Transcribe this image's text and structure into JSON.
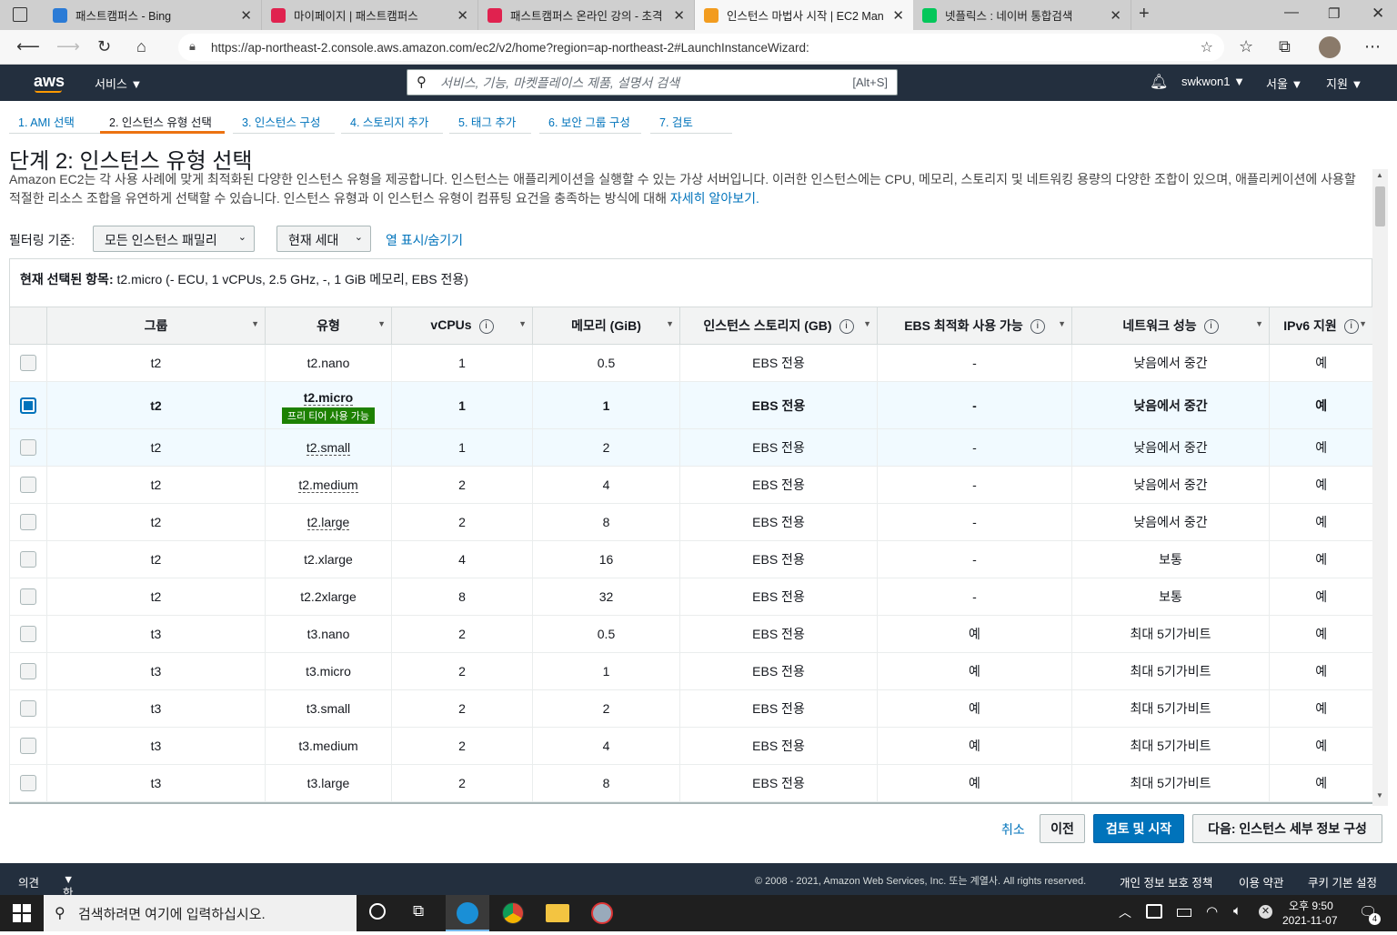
{
  "tabs": [
    {
      "title": "패스트캠퍼스 - Bing",
      "color": "#2b7bd6"
    },
    {
      "title": "마이페이지 | 패스트캠퍼스",
      "color": "#e0224f"
    },
    {
      "title": "패스트캠퍼스 온라인 강의 - 초격",
      "color": "#e0224f"
    },
    {
      "title": "인스턴스 마법사 시작 | EC2 Man",
      "color": "#f29c1f"
    },
    {
      "title": "넷플릭스 : 네이버 통합검색",
      "color": "#03c75a"
    }
  ],
  "browser": {
    "url": "https://ap-northeast-2.console.aws.amazon.com/ec2/v2/home?region=ap-northeast-2#LaunchInstanceWizard:"
  },
  "aws": {
    "logo": "aws",
    "services": "서비스",
    "search_placeholder": "서비스, 기능, 마켓플레이스 제품, 설명서 검색",
    "search_shortcut": "[Alt+S]",
    "user": "swkwon1",
    "region": "서울",
    "support": "지원"
  },
  "steps": [
    "1. AMI 선택",
    "2. 인스턴스 유형 선택",
    "3. 인스턴스 구성",
    "4. 스토리지 추가",
    "5. 태그 추가",
    "6. 보안 그룹 구성",
    "7. 검토"
  ],
  "page": {
    "title": "단계 2: 인스턴스 유형 선택",
    "description": "Amazon EC2는 각 사용 사례에 맞게 최적화된 다양한 인스턴스 유형을 제공합니다. 인스턴스는 애플리케이션을 실행할 수 있는 가상 서버입니다. 이러한 인스턴스에는 CPU, 메모리, 스토리지 및 네트워킹 용량의 다양한 조합이 있으며, 애플리케이션에 사용할 적절한 리소스 조합을 유연하게 선택할 수 있습니다. 인스턴스 유형과 이 인스턴스 유형이 컴퓨팅 요건을 충족하는 방식에 대해",
    "learn_more": "자세히 알아보기.",
    "filter_label": "필터링 기준:",
    "filter_family": "모든 인스턴스 패밀리",
    "filter_generation": "현재 세대",
    "toggle_columns": "열 표시/숨기기",
    "selected_label": "현재 선택된 항목:",
    "selected_value": "t2.micro (- ECU, 1 vCPUs, 2.5 GHz, -, 1 GiB 메모리, EBS 전용)"
  },
  "table": {
    "headers": [
      "그룹",
      "유형",
      "vCPUs",
      "메모리 (GiB)",
      "인스턴스 스토리지 (GB)",
      "EBS 최적화 사용 가능",
      "네트워크 성능",
      "IPv6 지원"
    ],
    "free_tier_badge": "프리 티어 사용 가능",
    "rows": [
      {
        "group": "t2",
        "type": "t2.nano",
        "vcpu": "1",
        "mem": "0.5",
        "storage": "EBS 전용",
        "ebs": "-",
        "net": "낮음에서 중간",
        "ipv6": "예",
        "checked": false
      },
      {
        "group": "t2",
        "type": "t2.micro",
        "vcpu": "1",
        "mem": "1",
        "storage": "EBS 전용",
        "ebs": "-",
        "net": "낮음에서 중간",
        "ipv6": "예",
        "checked": true
      },
      {
        "group": "t2",
        "type": "t2.small",
        "vcpu": "1",
        "mem": "2",
        "storage": "EBS 전용",
        "ebs": "-",
        "net": "낮음에서 중간",
        "ipv6": "예",
        "checked": false
      },
      {
        "group": "t2",
        "type": "t2.medium",
        "vcpu": "2",
        "mem": "4",
        "storage": "EBS 전용",
        "ebs": "-",
        "net": "낮음에서 중간",
        "ipv6": "예",
        "checked": false
      },
      {
        "group": "t2",
        "type": "t2.large",
        "vcpu": "2",
        "mem": "8",
        "storage": "EBS 전용",
        "ebs": "-",
        "net": "낮음에서 중간",
        "ipv6": "예",
        "checked": false
      },
      {
        "group": "t2",
        "type": "t2.xlarge",
        "vcpu": "4",
        "mem": "16",
        "storage": "EBS 전용",
        "ebs": "-",
        "net": "보통",
        "ipv6": "예",
        "checked": false
      },
      {
        "group": "t2",
        "type": "t2.2xlarge",
        "vcpu": "8",
        "mem": "32",
        "storage": "EBS 전용",
        "ebs": "-",
        "net": "보통",
        "ipv6": "예",
        "checked": false
      },
      {
        "group": "t3",
        "type": "t3.nano",
        "vcpu": "2",
        "mem": "0.5",
        "storage": "EBS 전용",
        "ebs": "예",
        "net": "최대 5기가비트",
        "ipv6": "예",
        "checked": false
      },
      {
        "group": "t3",
        "type": "t3.micro",
        "vcpu": "2",
        "mem": "1",
        "storage": "EBS 전용",
        "ebs": "예",
        "net": "최대 5기가비트",
        "ipv6": "예",
        "checked": false
      },
      {
        "group": "t3",
        "type": "t3.small",
        "vcpu": "2",
        "mem": "2",
        "storage": "EBS 전용",
        "ebs": "예",
        "net": "최대 5기가비트",
        "ipv6": "예",
        "checked": false
      },
      {
        "group": "t3",
        "type": "t3.medium",
        "vcpu": "2",
        "mem": "4",
        "storage": "EBS 전용",
        "ebs": "예",
        "net": "최대 5기가비트",
        "ipv6": "예",
        "checked": false
      },
      {
        "group": "t3",
        "type": "t3.large",
        "vcpu": "2",
        "mem": "8",
        "storage": "EBS 전용",
        "ebs": "예",
        "net": "최대 5기가비트",
        "ipv6": "예",
        "checked": false
      }
    ]
  },
  "buttons": {
    "cancel": "취소",
    "prev": "이전",
    "review": "검토 및 시작",
    "next": "다음: 인스턴스 세부 정보 구성"
  },
  "footer": {
    "feedback": "의견",
    "language": "한국어",
    "copyright": "© 2008 - 2021, Amazon Web Services, Inc. 또는 계열사. All rights reserved.",
    "privacy": "개인 정보 보호 정책",
    "terms": "이용 약관",
    "cookies": "쿠키 기본 설정"
  },
  "taskbar": {
    "search": "검색하려면 여기에 입력하십시오.",
    "time": "오후 9:50",
    "date": "2021-11-07",
    "notif_count": "4"
  }
}
